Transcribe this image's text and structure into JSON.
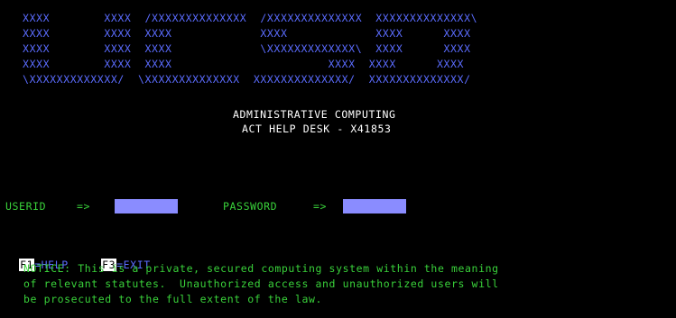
{
  "logo": {
    "rows": [
      "  XXXX        XXXX  /XXXXXXXXXXXXXX  /XXXXXXXXXXXXXX  XXXXXXXXXXXXXX\\",
      "  XXXX        XXXX  XXXX             XXXX             XXXX      XXXX",
      "  XXXX        XXXX  XXXX             \\XXXXXXXXXXXXX\\  XXXX      XXXX",
      "  XXXX        XXXX  XXXX                       XXXX  XXXX      XXXX",
      "  \\XXXXXXXXXXXXX/  \\XXXXXXXXXXXXXX  XXXXXXXXXXXXXX/  XXXXXXXXXXXXXX/"
    ]
  },
  "header": {
    "title": "ADMINISTRATIVE COMPUTING",
    "subtitle": "ACT HELP DESK - X41853"
  },
  "login": {
    "userid_label": "USERID",
    "userid_arrow": "=>",
    "userid_value": "",
    "password_label": "PASSWORD",
    "password_arrow": "=>",
    "password_value": ""
  },
  "function_keys": {
    "f1_key": "F1",
    "f1_label": "=HELP",
    "f3_key": "F3",
    "f3_label": "=EXIT"
  },
  "notice": {
    "line1": "NOTICE: This is a private, secured computing system within the meaning",
    "line2": "of relevant statutes.  Unauthorized access and unauthorized users will",
    "line3": "be prosecuted to the full extent of the law."
  },
  "colors": {
    "background": "#000000",
    "logo": "#5b6cff",
    "text": "#ffffff",
    "notice": "#39d13a",
    "field": "#8a8cff"
  }
}
